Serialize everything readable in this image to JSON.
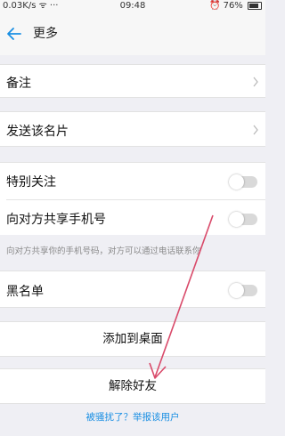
{
  "status_bar": {
    "left": "0.03K/s ᯤ ···",
    "time": "09:48",
    "battery": "76%"
  },
  "header": {
    "title": "更多"
  },
  "rows": {
    "remark": "备注",
    "send_card": "发送该名片",
    "special_follow": "特别关注",
    "share_phone": "向对方共享手机号",
    "share_phone_hint": "向对方共享你的手机号码，对方可以通过电话联系你",
    "blacklist": "黑名单"
  },
  "toggles": {
    "special_follow": false,
    "share_phone": false,
    "blacklist": false
  },
  "actions": {
    "add_to_desktop": "添加到桌面",
    "delete_friend": "解除好友",
    "report": "被骚扰了？举报该用户"
  },
  "colors": {
    "accent": "#1a8fe3",
    "annotation": "#d94a6a"
  }
}
